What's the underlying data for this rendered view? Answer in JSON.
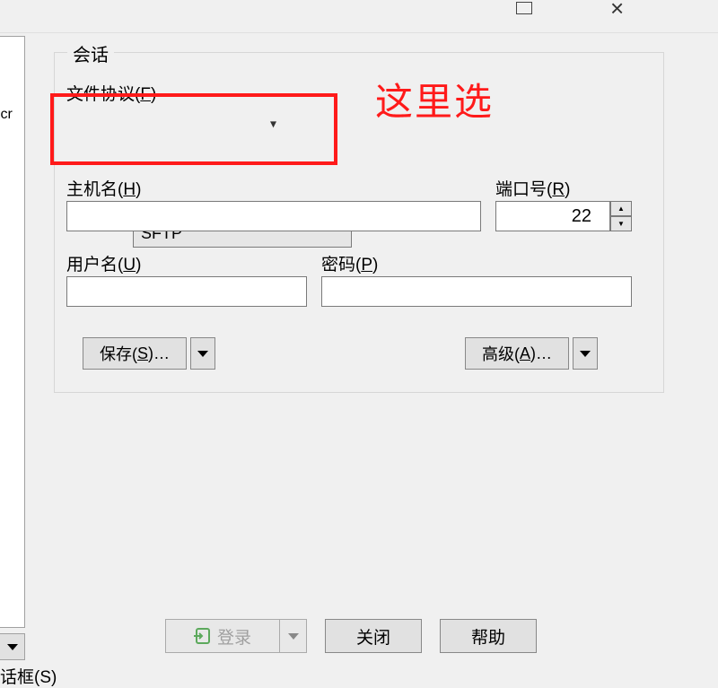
{
  "titlebar": {
    "maximize_icon": "maximize",
    "close_icon": "×"
  },
  "left": {
    "frag_text": ".cr",
    "dialog_label_frag": "话框(S)"
  },
  "annotation": {
    "text": "这里选"
  },
  "session": {
    "group_label": "会话",
    "protocol_label": "文件协议(F)",
    "protocol_value": "SFTP",
    "host_label": "主机名(H)",
    "host_value": "",
    "port_label": "端口号(R)",
    "port_value": "22",
    "user_label": "用户名(U)",
    "user_value": "",
    "pass_label": "密码(P)",
    "pass_value": "",
    "save_btn": "保存(S)…",
    "advanced_btn": "高级(A)…"
  },
  "buttons": {
    "login": "登录",
    "close": "关闭",
    "help": "帮助"
  }
}
